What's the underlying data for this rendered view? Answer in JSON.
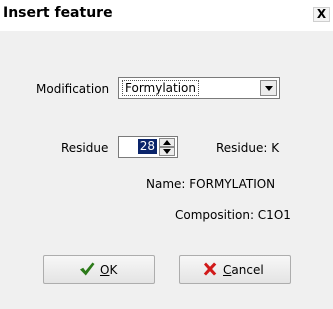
{
  "window": {
    "title": "Insert feature",
    "close_glyph": "X"
  },
  "form": {
    "modification_label": "Modification",
    "modification_value": "Formylation",
    "residue_label": "Residue",
    "residue_value": "28",
    "residue_info": "Residue: K",
    "name_info": "Name: FORMYLATION",
    "composition_info": "Composition: C1O1"
  },
  "buttons": {
    "ok_mnemonic": "O",
    "ok_rest": "K",
    "cancel_mnemonic": "C",
    "cancel_rest": "ancel"
  },
  "icons": {
    "ok": "checkmark-icon",
    "cancel": "x-mark-icon"
  },
  "colors": {
    "ok_icon": "#2c7a1a",
    "cancel_icon": "#d11a1a",
    "selection": "#0a246a"
  }
}
